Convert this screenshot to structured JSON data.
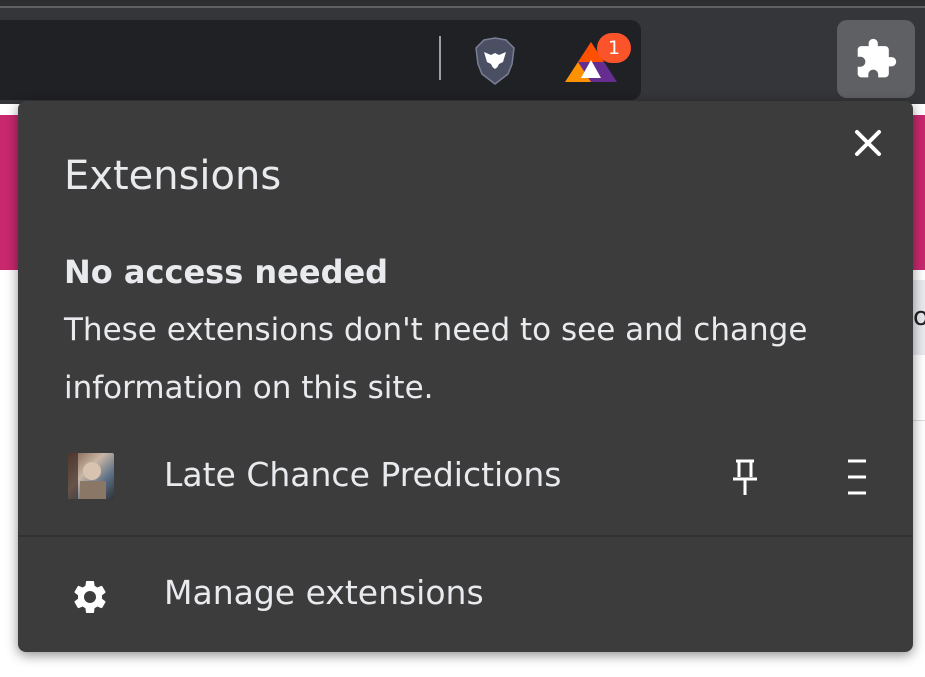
{
  "toolbar": {
    "brave_shields_icon": "lion-icon",
    "rewards_icon": "bat-triangle-icon",
    "rewards_badge": "1",
    "extensions_icon": "puzzle-icon"
  },
  "panel": {
    "title": "Extensions",
    "close_icon": "close-icon",
    "section": {
      "heading": "No access needed",
      "description": "These extensions don't need to see and change information on this site."
    },
    "extensions": [
      {
        "name": "Late Chance Predictions",
        "pin_icon": "pin-icon",
        "menu_icon": "menu-icon"
      }
    ],
    "manage": {
      "label": "Manage extensions",
      "icon": "gear-icon"
    }
  },
  "page": {
    "right_edge_text": "o"
  },
  "colors": {
    "panel_bg": "#3c3c3c",
    "toolbar_bg": "#35363a",
    "omnibox_bg": "#202124",
    "page_accent": "#c8286e",
    "badge": "#fb542b",
    "text": "#e8eaed"
  }
}
